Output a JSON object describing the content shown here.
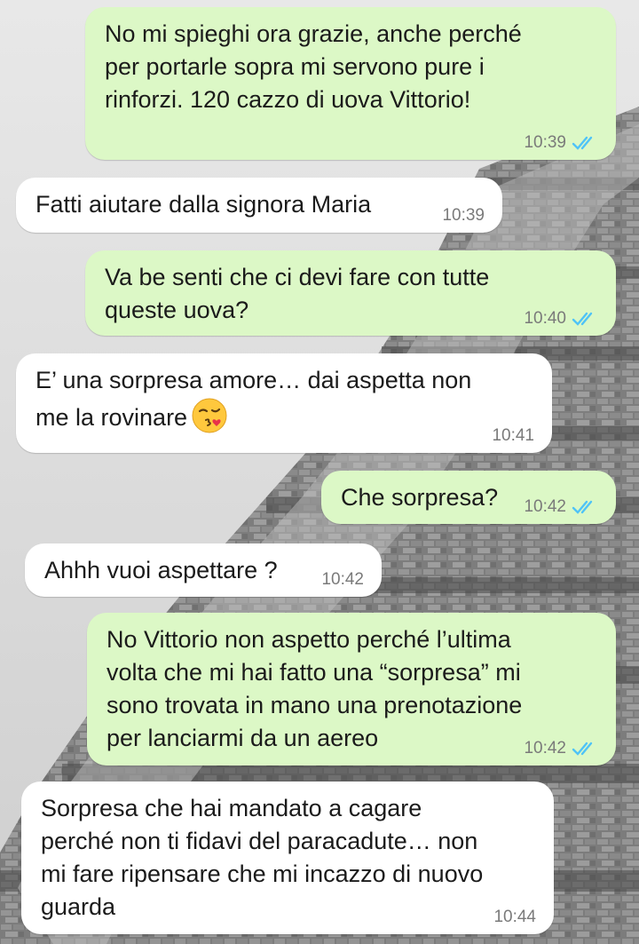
{
  "colors": {
    "outgoing_bubble": "#dcf8c6",
    "incoming_bubble": "#ffffff",
    "read_ticks": "#4fc3f7",
    "timestamp": "#7a7a7a"
  },
  "messages": [
    {
      "direction": "outgoing",
      "text": "No mi spieghi ora grazie, anche perché\nper portarle sopra mi servono pure i\nrinforzi. 120 cazzo di uova Vittorio!",
      "time": "10:39",
      "status_icon": "double-check-read-icon"
    },
    {
      "direction": "incoming",
      "text": "Fatti aiutare dalla signora Maria",
      "time": "10:39"
    },
    {
      "direction": "outgoing",
      "text": "Va be senti che ci devi fare con tutte\nqueste uova?",
      "time": "10:40",
      "status_icon": "double-check-read-icon"
    },
    {
      "direction": "incoming",
      "text": "E’ una sorpresa amore… dai aspetta non\nme la rovinare",
      "emoji": "face-blowing-a-kiss-emoji",
      "time": "10:41"
    },
    {
      "direction": "outgoing",
      "text": "Che sorpresa?",
      "time": "10:42",
      "status_icon": "double-check-read-icon"
    },
    {
      "direction": "incoming",
      "text": "Ahhh vuoi aspettare ?",
      "time": "10:42"
    },
    {
      "direction": "outgoing",
      "text": "No Vittorio non aspetto perché l’ultima\nvolta che mi hai fatto una “sorpresa” mi\nsono trovata in mano una prenotazione\nper lanciarmi da un aereo",
      "time": "10:42",
      "status_icon": "double-check-read-icon"
    },
    {
      "direction": "incoming",
      "text": "Sorpresa che hai mandato a cagare\nperché non ti fidavi del paracadute… non\nmi fare ripensare che mi incazzo di nuovo\nguarda",
      "time": "10:44"
    }
  ]
}
